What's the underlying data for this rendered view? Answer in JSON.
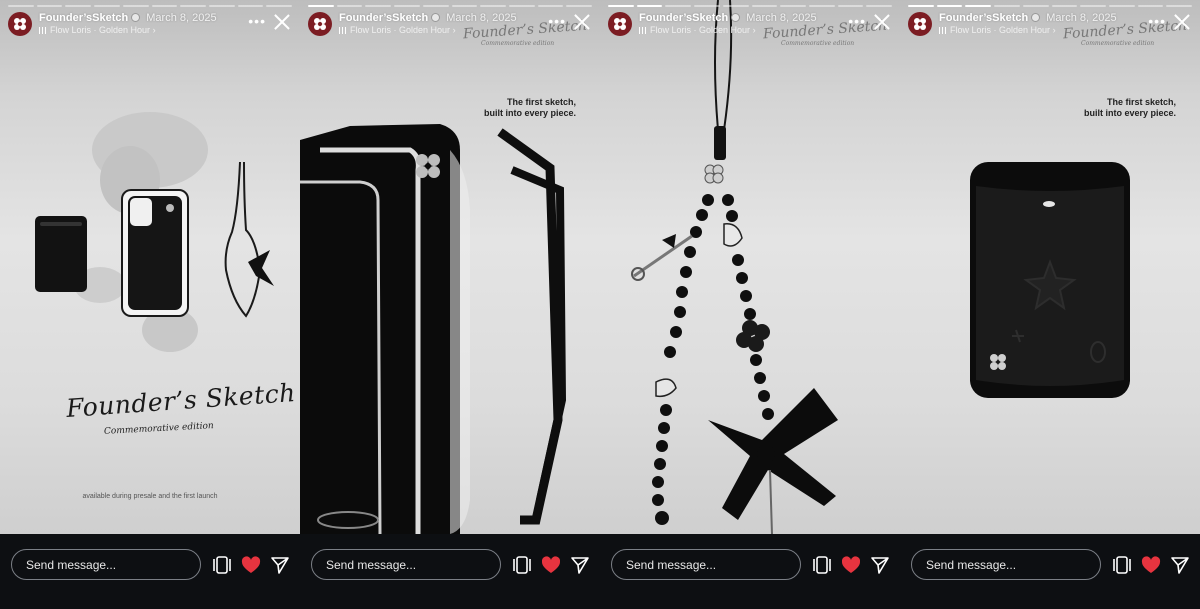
{
  "colors": {
    "avatar": "#7c1d23",
    "like": "#e7343f",
    "bottom_bar": "#0d0f12"
  },
  "panels": [
    {
      "username": "Founder’sSketch",
      "date": "March 8, 2025",
      "music": "Flow Loris · Golden Hour",
      "music_chevron": "›",
      "more": "•••",
      "caption": "",
      "script_title": "Founder’s Sketch",
      "script_subtitle": "Commemorative edition",
      "footer": "available during presale and the first launch",
      "message_placeholder": "Send message...",
      "progress": [
        0,
        0,
        0,
        0,
        0,
        0,
        0,
        0,
        0,
        0
      ],
      "icons": [
        "carousel-icon",
        "heart-icon",
        "send-icon"
      ]
    },
    {
      "username": "Founder’sSketch",
      "date": "March 8, 2025",
      "music": "Flow Loris · Golden Hour",
      "music_chevron": "›",
      "more": "•••",
      "caption": "The first sketch,\nbuilt into every piece.",
      "watermark_title": "Founder’s Sketch",
      "watermark_subtitle": "Commemorative edition",
      "message_placeholder": "Send message...",
      "progress": [
        1,
        0,
        0,
        0,
        0,
        0,
        0,
        0,
        0,
        0
      ],
      "icons": [
        "carousel-icon",
        "heart-icon",
        "send-icon"
      ]
    },
    {
      "username": "Founder’sSketch",
      "date": "March 8, 2025",
      "music": "Flow Loris · Golden Hour",
      "music_chevron": "›",
      "more": "•••",
      "caption": "",
      "watermark_title": "Founder’s Sketch",
      "watermark_subtitle": "Commemorative edition",
      "message_placeholder": "Send message...",
      "progress": [
        1,
        1,
        0,
        0,
        0,
        0,
        0,
        0,
        0,
        0
      ],
      "icons": [
        "carousel-icon",
        "heart-icon",
        "send-icon"
      ]
    },
    {
      "username": "Founder’sSketch",
      "date": "March 8, 2025",
      "music": "Flow Loris · Golden Hour",
      "music_chevron": "›",
      "more": "•••",
      "caption": "The first sketch,\nbuilt into every piece.",
      "watermark_title": "Founder’s Sketch",
      "watermark_subtitle": "Commemorative edition",
      "message_placeholder": "Send message...",
      "progress": [
        1,
        1,
        1,
        0,
        0,
        0,
        0,
        0,
        0,
        0
      ],
      "icons": [
        "carousel-icon",
        "heart-icon",
        "send-icon"
      ]
    }
  ]
}
